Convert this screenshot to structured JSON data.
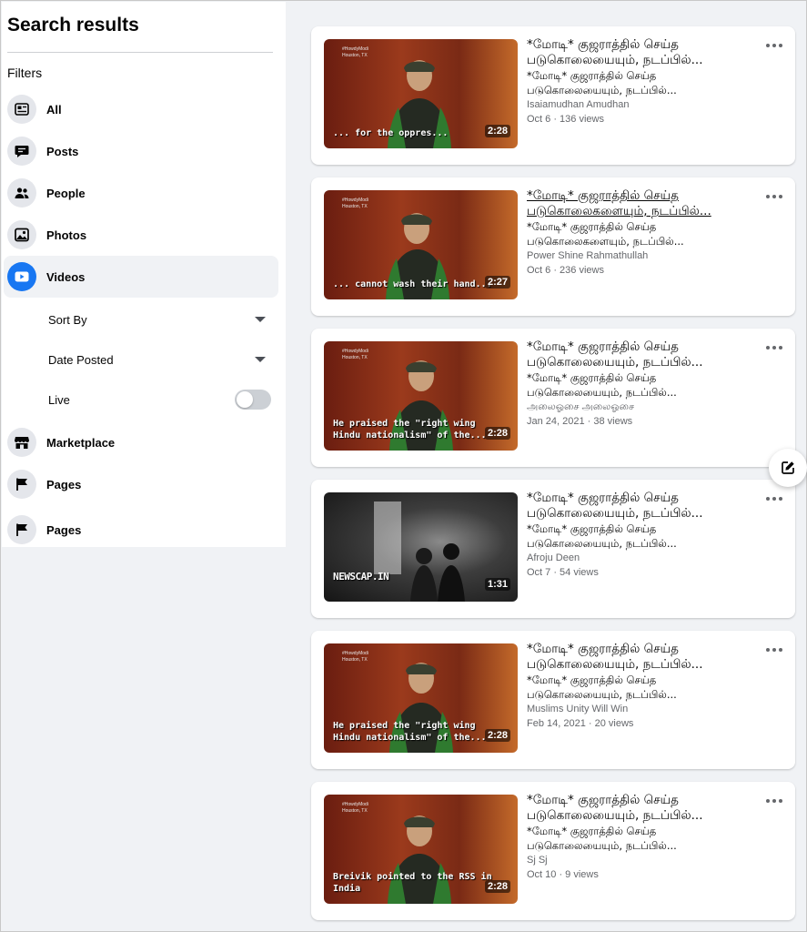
{
  "sidebar": {
    "title": "Search results",
    "filters_label": "Filters",
    "items": [
      {
        "label": "All",
        "icon": "all-icon"
      },
      {
        "label": "Posts",
        "icon": "posts-icon"
      },
      {
        "label": "People",
        "icon": "people-icon"
      },
      {
        "label": "Photos",
        "icon": "photos-icon"
      },
      {
        "label": "Videos",
        "icon": "video-icon",
        "active": true
      },
      {
        "label": "Marketplace",
        "icon": "marketplace-icon"
      },
      {
        "label": "Pages",
        "icon": "flag-icon"
      },
      {
        "label": "Pages",
        "icon": "flag-icon"
      }
    ],
    "video_filters": {
      "sort_by": "Sort By",
      "date_posted": "Date Posted",
      "live": "Live",
      "live_enabled": false
    }
  },
  "results": [
    {
      "title_line1": "*மோடி* குஜராத்தில் செய்த",
      "title_line2": "படுகொலையையும், நடப்பில்...",
      "desc_line1": "*மோடி* குஜராத்தில் செய்த",
      "desc_line2": "படுகொலையையும், நடப்பில்...",
      "author": "Isaiamudhan Amudhan",
      "meta": "Oct 6 · 136 views",
      "duration": "2:28",
      "caption": "... for the oppres...",
      "watermark": "#HowdyModi\nHouston, TX"
    },
    {
      "title_line1": "*மோடி* குஜராத்தில் செய்த",
      "title_line2": "படுகொலைகளையும், நடப்பில்...",
      "desc_line1": "*மோடி* குஜராத்தில் செய்த",
      "desc_line2": "படுகொலைகளையும், நடப்பில்...",
      "author": "Power Shine Rahmathullah",
      "meta": "Oct 6 · 236 views",
      "duration": "2:27",
      "caption": "... cannot wash their hand...",
      "watermark": "#HowdyModi\nHouston, TX"
    },
    {
      "title_line1": "*மோடி* குஜராத்தில் செய்த",
      "title_line2": "படுகொலையையும், நடப்பில்...",
      "desc_line1": "*மோடி* குஜராத்தில் செய்த",
      "desc_line2": "படுகொலையையும், நடப்பில்...",
      "author": "அலைஓசை அலைஓசை",
      "meta": "Jan 24, 2021 · 38 views",
      "duration": "2:28",
      "caption": "He praised the \"right wing\nHindu nationalism\" of the...",
      "watermark": "#HowdyModi\nHouston, TX"
    },
    {
      "title_line1": "*மோடி* குஜராத்தில் செய்த",
      "title_line2": "படுகொலையையும், நடப்பில்...",
      "desc_line1": "*மோடி* குஜராத்தில் செய்த",
      "desc_line2": "படுகொலையையும், நடப்பில்...",
      "author": "Afroju Deen",
      "meta": "Oct 7 · 54 views",
      "duration": "1:31",
      "caption": "NEWSCAP.IN",
      "watermark": ""
    },
    {
      "title_line1": "*மோடி* குஜராத்தில் செய்த",
      "title_line2": "படுகொலையையும், நடப்பில்...",
      "desc_line1": "*மோடி* குஜராத்தில் செய்த",
      "desc_line2": "படுகொலையையும், நடப்பில்...",
      "author": "Muslims Unity Will Win",
      "meta": "Feb 14, 2021 · 20 views",
      "duration": "2:28",
      "caption": "He praised the \"right wing\nHindu nationalism\" of the...",
      "watermark": "#HowdyModi\nHouston, TX"
    },
    {
      "title_line1": "*மோடி* குஜராத்தில் செய்த",
      "title_line2": "படுகொலையையும், நடப்பில்...",
      "desc_line1": "*மோடி* குஜராத்தில் செய்த",
      "desc_line2": "படுகொலையையும், நடப்பில்...",
      "author": "Sj Sj",
      "meta": "Oct 10 · 9 views",
      "duration": "2:28",
      "caption": "Breivik pointed to the RSS in\nIndia",
      "watermark": "#HowdyModi\nHouston, TX"
    }
  ],
  "colors": {
    "accent": "#1877f2",
    "page_bg": "#f0f2f5",
    "secondary_text": "#65676b"
  }
}
